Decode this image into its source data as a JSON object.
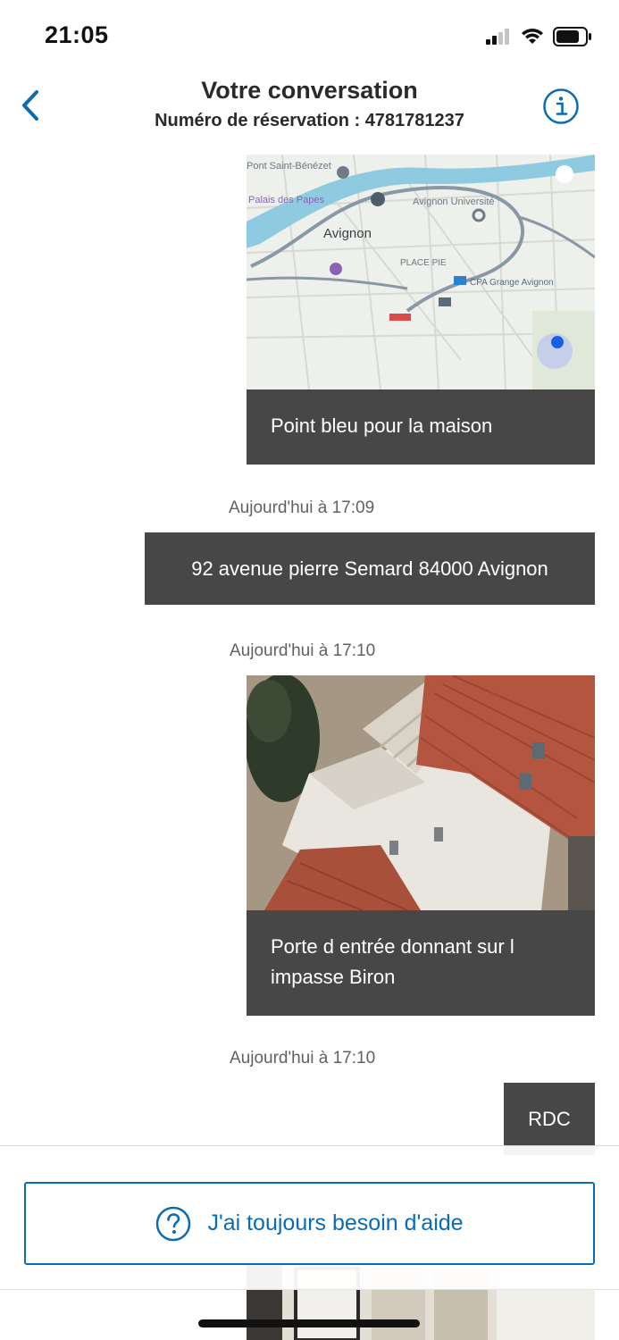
{
  "status_bar": {
    "time": "21:05"
  },
  "header": {
    "title": "Votre conversation",
    "subtitle": "Numéro de réservation : 4781781237",
    "back_icon": "chevron-left-icon",
    "info_icon": "info-circle-icon"
  },
  "messages": [
    {
      "type": "image",
      "image": "map",
      "caption": "Point bleu pour la maison",
      "map_labels": {
        "city": "Avignon",
        "place": "PLACE PIE",
        "station": "CPA Grange Avignon",
        "top_left": "Pont Saint-Bénézet",
        "palace": "Palais des Papes",
        "university": "Avignon Université"
      }
    },
    {
      "timestamp": "Aujourd'hui à 17:09",
      "type": "text",
      "text": "92 avenue pierre Semard 84000 Avignon"
    },
    {
      "timestamp": "Aujourd'hui à 17:10",
      "type": "image",
      "image": "house-photo",
      "caption": "Porte d entrée donnant sur l impasse Biron"
    },
    {
      "timestamp": "Aujourd'hui à 17:10",
      "type": "text",
      "text": "RDC"
    }
  ],
  "help": {
    "label": "J'ai toujours besoin d'aide",
    "icon": "question-circle-icon"
  },
  "colors": {
    "accent": "#0a6bb6",
    "bubble": "#474747",
    "bubble_text": "#ffffff",
    "timestamp": "#616161"
  }
}
